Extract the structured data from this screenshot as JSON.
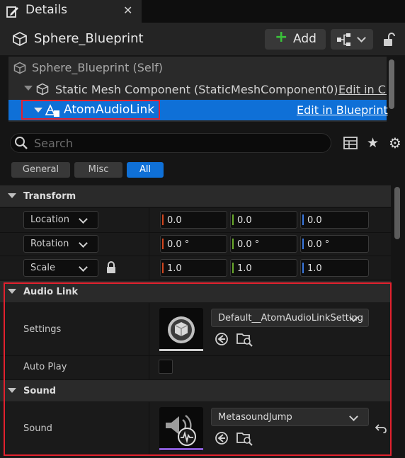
{
  "tab": {
    "title": "Details",
    "close": "✕"
  },
  "header": {
    "object_name": "Sphere_Blueprint",
    "add_label": "Add"
  },
  "tree": {
    "root": "Sphere_Blueprint (Self)",
    "component": "Static Mesh Component (StaticMeshComponent0)",
    "component_edit": "Edit in C++",
    "selected": "AtomAudioLink",
    "selected_edit": "Edit in Blueprint"
  },
  "search": {
    "placeholder": "Search"
  },
  "filters": [
    "General",
    "Misc",
    "All"
  ],
  "transform": {
    "title": "Transform",
    "location_label": "Location",
    "rotation_label": "Rotation",
    "scale_label": "Scale",
    "location": [
      "0.0",
      "0.0",
      "0.0"
    ],
    "rotation": [
      "0.0 °",
      "0.0 °",
      "0.0 °"
    ],
    "scale": [
      "1.0",
      "1.0",
      "1.0"
    ]
  },
  "audio_link": {
    "title": "Audio Link",
    "settings_label": "Settings",
    "settings_value": "Default__AtomAudioLinkSetting",
    "auto_play_label": "Auto Play",
    "auto_play": false
  },
  "sound": {
    "title": "Sound",
    "sound_label": "Sound",
    "sound_value": "MetasoundJump"
  },
  "colors": {
    "accent": "#0f70d7",
    "highlight": "#e3212e",
    "axis_x": "#d2461e",
    "axis_y": "#6aaa2c",
    "axis_z": "#3a78e0",
    "add_green": "#3ac13a"
  },
  "icons": [
    "pencil-icon",
    "close-icon",
    "cube-icon",
    "plus-icon",
    "blueprint-icon",
    "lock-icon",
    "search-icon",
    "grid-icon",
    "star-icon",
    "gear-icon",
    "browse-icon",
    "folder-search-icon",
    "speaker-icon",
    "reset-icon"
  ]
}
